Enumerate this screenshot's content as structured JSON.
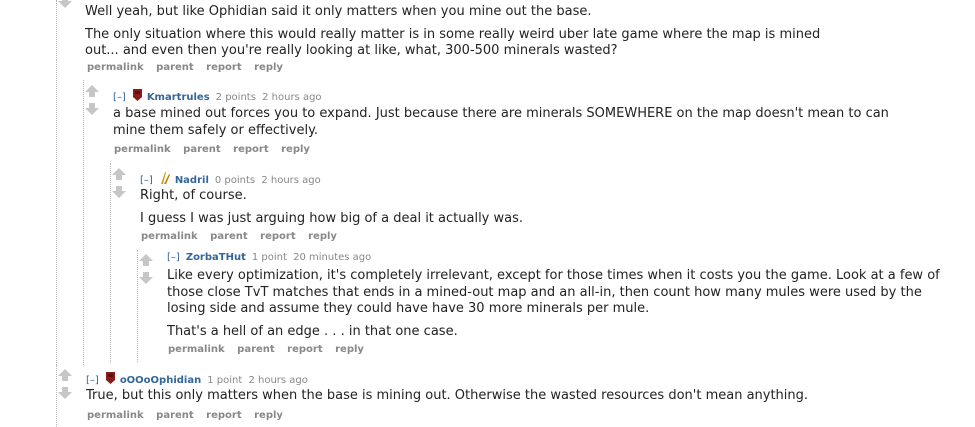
{
  "comments": [
    {
      "paragraphs": [
        "Well yeah, but like Ophidian said it only matters when you mine out the base.",
        "The only situation where this would really matter is in some really weird uber late game where the map is mined out... and even then you're really looking at like, what, 300-500 minerals wasted?"
      ],
      "buttons": [
        "permalink",
        "parent",
        "report",
        "reply"
      ]
    },
    {
      "collapse": "[–]",
      "flair_icon": "terran-flair-icon",
      "author": "Kmartrules",
      "score": "2 points",
      "time": "2 hours ago",
      "paragraphs": [
        "a base mined out forces you to expand. Just because there are minerals SOMEWHERE on the map doesn't mean to can mine them safely or effectively."
      ],
      "buttons": [
        "permalink",
        "parent",
        "report",
        "reply"
      ]
    },
    {
      "collapse": "[–]",
      "flair_icon": "protoss-flair-icon",
      "author": "Nadril",
      "score": "0 points",
      "time": "2 hours ago",
      "paragraphs": [
        "Right, of course.",
        "I guess I was just arguing how big of a deal it actually was."
      ],
      "buttons": [
        "permalink",
        "parent",
        "report",
        "reply"
      ]
    },
    {
      "collapse": "[–]",
      "author": "ZorbaTHut",
      "score": "1 point",
      "time": "20 minutes ago",
      "paragraphs": [
        "Like every optimization, it's completely irrelevant, except for those times when it costs you the game. Look at a few of those close TvT matches that ends in a mined-out map and an all-in, then count how many mules were used by the losing side and assume they could have have 30 more minerals per mule.",
        "That's a hell of an edge . . . in that one case."
      ],
      "buttons": [
        "permalink",
        "parent",
        "report",
        "reply"
      ]
    },
    {
      "collapse": "[–]",
      "flair_icon": "terran-flair-icon",
      "author": "oOOoOphidian",
      "score": "1 point",
      "time": "2 hours ago",
      "paragraphs": [
        "True, but this only matters when the base is mining out. Otherwise the wasted resources don't mean anything."
      ],
      "buttons": [
        "permalink",
        "parent",
        "report",
        "reply"
      ]
    }
  ],
  "colors": {
    "author": "#336699",
    "meta": "#888888",
    "arrow": "#c6c6c6",
    "terran_flair": "#8b1a1a",
    "protoss_flair": "#d4a017"
  }
}
